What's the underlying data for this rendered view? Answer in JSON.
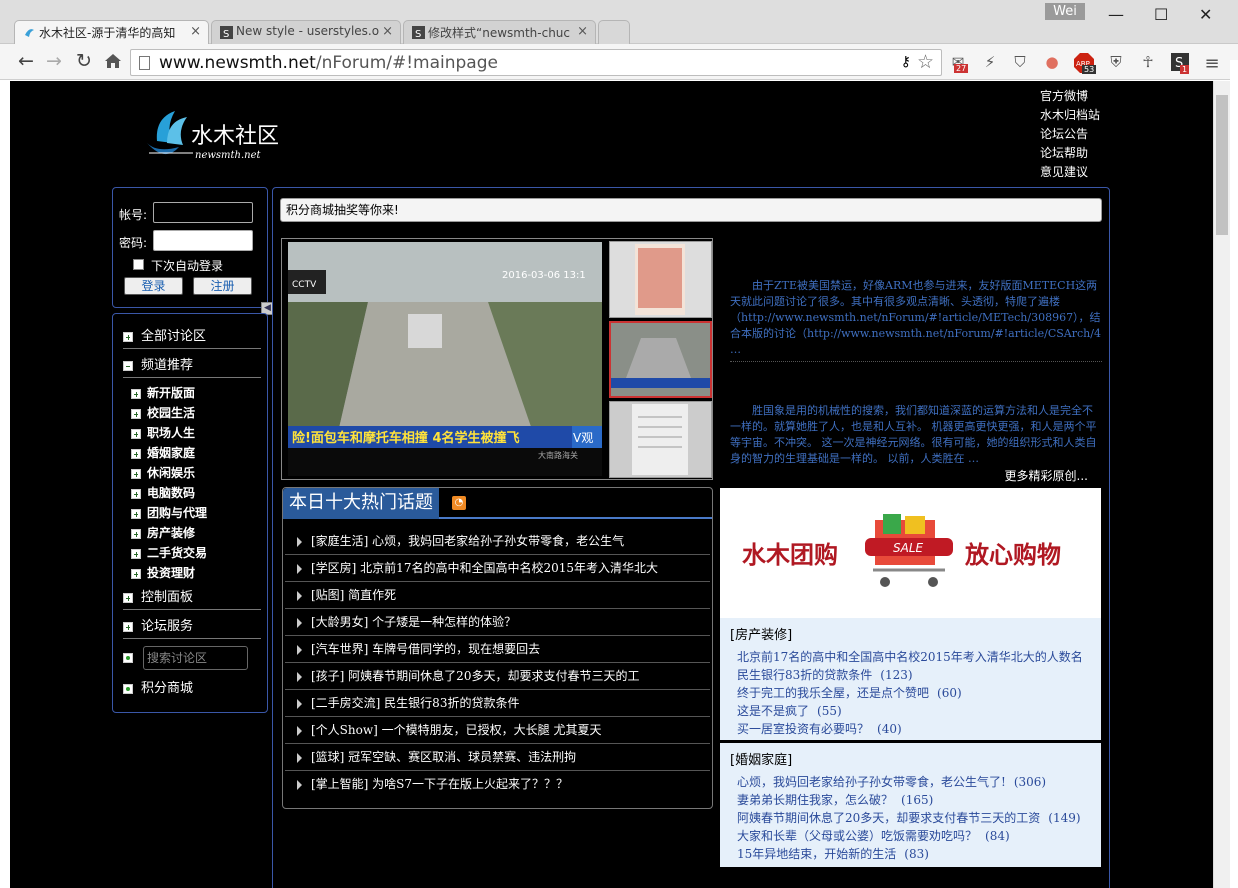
{
  "browser": {
    "tabs": [
      {
        "label": "水木社区-源于清华的高知",
        "close": "×"
      },
      {
        "label": "New style - userstyles.o",
        "close": "×"
      },
      {
        "label": "修改样式“newsmth-chuc",
        "close": "×"
      }
    ],
    "user": "Wei",
    "window_buttons": [
      "—",
      "☐",
      "✕"
    ],
    "url_host": "www.newsmth.net",
    "url_path": "/nForum/#!mainpage",
    "ext_badges": {
      "badge1": "27",
      "badge2": "53",
      "badge3": "1"
    },
    "ext_abp": "ABP"
  },
  "site": {
    "logo_text": "水木社区",
    "logo_sub": "newsmth.net",
    "top_links": [
      "官方微博",
      "水木归档站",
      "论坛公告",
      "论坛帮助",
      "意见建议"
    ]
  },
  "login": {
    "account_label": "帐号:",
    "password_label": "密码:",
    "remember_label": "下次自动登录",
    "login_btn": "登录",
    "register_btn": "注册"
  },
  "nav": {
    "all": "全部讨论区",
    "channels": "频道推荐",
    "channel_items": [
      "新开版面",
      "校园生活",
      "职场人生",
      "婚姻家庭",
      "休闲娱乐",
      "电脑数码",
      "团购与代理",
      "房产装修",
      "二手货交易",
      "投资理财"
    ],
    "control": "控制面板",
    "service": "论坛服务",
    "search_placeholder": "搜索讨论区",
    "mall": "积分商城"
  },
  "notice": "积分商城抽奖等你来!",
  "slider": {
    "timestamp": "2016-03-06 13:1",
    "caption": "险!面包车和摩托车相撞 4名学生被撞飞",
    "logo": "V观",
    "sub": "大南路海关",
    "station": "CCTV"
  },
  "features": {
    "p1": "由于ZTE被美国禁运，好像ARM也参与进来，友好版面METECH这两天就此问题讨论了很多。其中有很多观点清晰、头透彻，特爬了遍楼（http://www.newsmth.net/nForum/#!article/METech/308967），结合本版的讨论（http://www.newsmth.net/nForum/#!article/CSArch/4 …",
    "p2": "胜国象是用的机械性的搜索，我们都知道深蓝的运算方法和人是完全不一样的。就算她胜了人，也是和人互补。 机器更高更快更强，和人是两个平等宇宙。不冲突。 这一次是神经元网络。很有可能，她的组织形式和人类自身的智力的生理基础是一样的。 以前，人类胜在 …",
    "more": "更多精彩原创..."
  },
  "hot": {
    "title": "本日十大热门话题",
    "rss": "RSS",
    "items": [
      "[家庭生活]  心烦，我妈回老家给孙子孙女带零食，老公生气",
      "[学区房]  北京前17名的高中和全国高中名校2015年考入清华北大",
      "[贴图]  简直作死",
      "[大龄男女]  个子矮是一种怎样的体验？",
      "[汽车世界]  车牌号借同学的，现在想要回去",
      "[孩子]  阿姨春节期间休息了20多天，却要求支付春节三天的工",
      "[二手房交流]  民生银行83折的贷款条件",
      "[个人Show]  一个模特朋友，已授权，大长腿 尤其夏天",
      "[篮球]  冠军空缺、赛区取消、球员禁赛、违法刑拘",
      "[掌上智能]  为啥S7一下子在版上火起来了？？？"
    ]
  },
  "promo": {
    "left": "水木团购",
    "right": "放心购物",
    "sale": "SALE"
  },
  "sections": [
    {
      "name": "[房产装修]",
      "items": [
        {
          "t": "北京前17名的高中和全国高中名校2015年考入清华北大的人数名",
          "c": ""
        },
        {
          "t": "民生银行83折的贷款条件",
          "c": "(123)"
        },
        {
          "t": "终于完工的我乐全屋，还是点个赞吧",
          "c": "(60)"
        },
        {
          "t": "这是不是疯了",
          "c": "(55)"
        },
        {
          "t": "买一居室投资有必要吗？",
          "c": "(40)"
        }
      ]
    },
    {
      "name": "[婚姻家庭]",
      "items": [
        {
          "t": "心烦，我妈回老家给孙子孙女带零食，老公生气了!",
          "c": "(306)"
        },
        {
          "t": "妻弟弟长期住我家，怎么破？",
          "c": "(165)"
        },
        {
          "t": "阿姨春节期间休息了20多天，却要求支付春节三天的工资",
          "c": "(149)"
        },
        {
          "t": "大家和长辈（父母或公婆）吃饭需要劝吃吗？",
          "c": "(84)"
        },
        {
          "t": "15年异地结束，开始新的生活",
          "c": "(83)"
        }
      ]
    }
  ]
}
